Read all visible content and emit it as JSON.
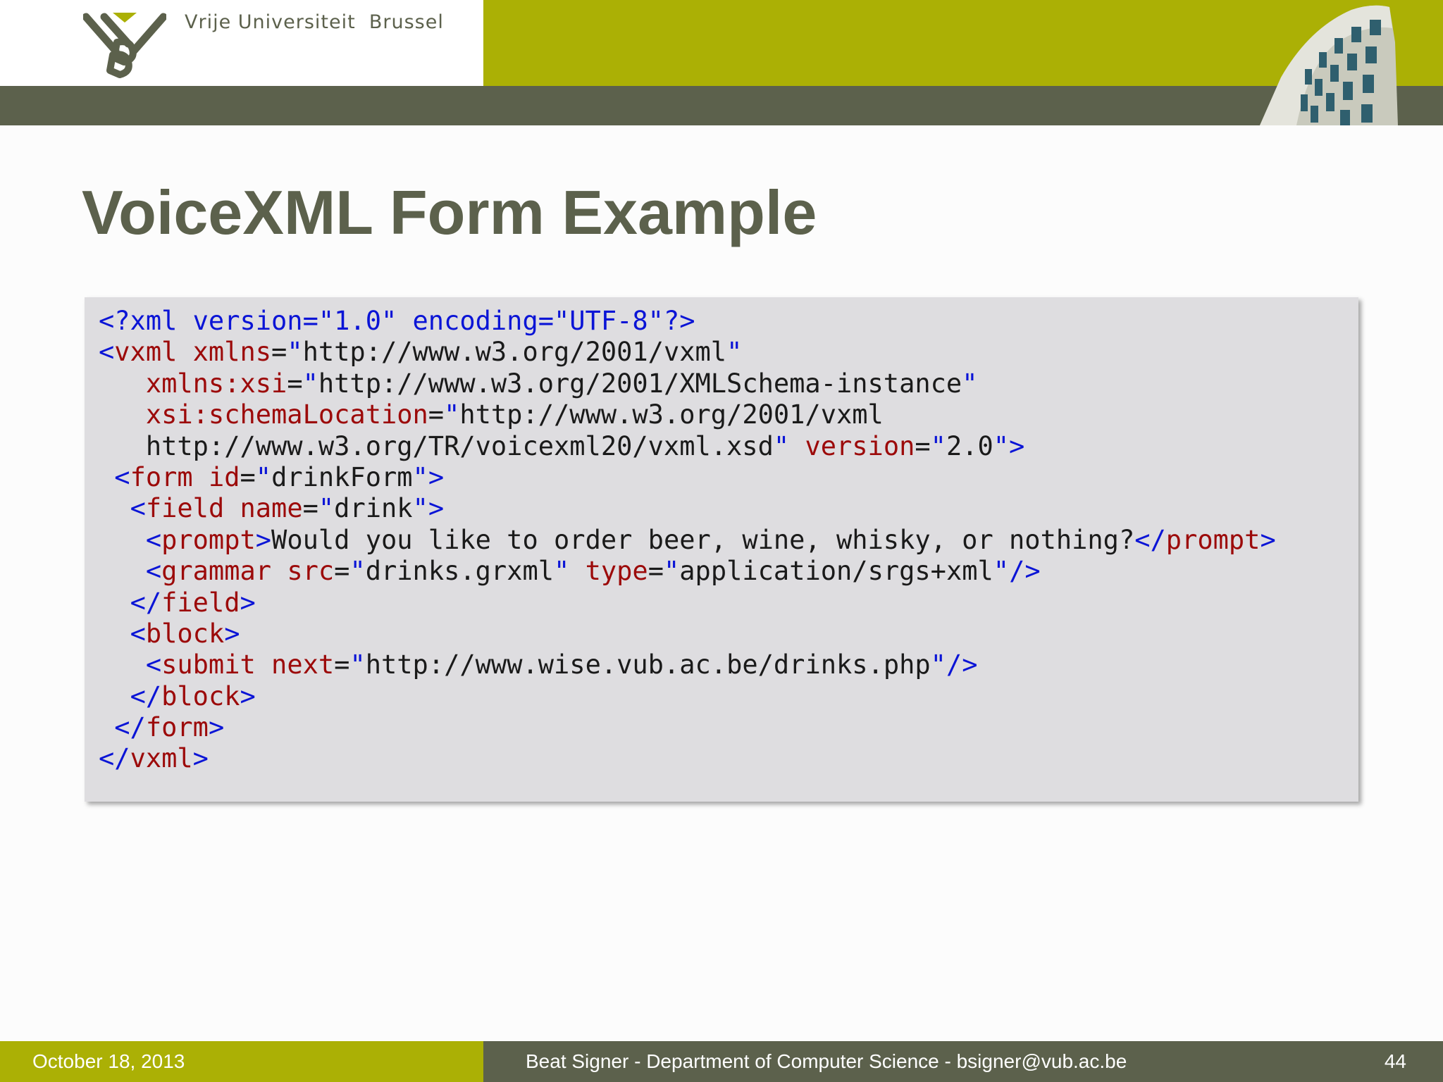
{
  "header": {
    "university_name": "Vrije Universiteit  Brussel",
    "logo_icon": "vub-logo-icon",
    "building_image": "building-photo-icon"
  },
  "slide": {
    "title": "VoiceXML Form Example"
  },
  "code": {
    "language": "xml",
    "lines": [
      [
        [
          "b",
          "<?xml version=\"1.0\" encoding=\"UTF-8\"?>"
        ]
      ],
      [
        [
          "b",
          "<"
        ],
        [
          "r",
          "vxml xmlns"
        ],
        [
          "k",
          "="
        ],
        [
          "b",
          "\""
        ],
        [
          "k",
          "http://www.w3.org/2001/vxml"
        ],
        [
          "b",
          "\""
        ]
      ],
      [
        [
          "k",
          "   "
        ],
        [
          "r",
          "xmlns:xsi"
        ],
        [
          "k",
          "="
        ],
        [
          "b",
          "\""
        ],
        [
          "k",
          "http://www.w3.org/2001/XMLSchema-instance"
        ],
        [
          "b",
          "\""
        ]
      ],
      [
        [
          "k",
          "   "
        ],
        [
          "r",
          "xsi:schemaLocation"
        ],
        [
          "k",
          "="
        ],
        [
          "b",
          "\""
        ],
        [
          "k",
          "http://www.w3.org/2001/vxml"
        ]
      ],
      [
        [
          "k",
          "   http://www.w3.org/TR/voicexml20/vxml.xsd"
        ],
        [
          "b",
          "\""
        ],
        [
          "k",
          " "
        ],
        [
          "r",
          "version"
        ],
        [
          "k",
          "="
        ],
        [
          "b",
          "\""
        ],
        [
          "k",
          "2.0"
        ],
        [
          "b",
          "\">"
        ]
      ],
      [
        [
          "k",
          " "
        ],
        [
          "b",
          "<"
        ],
        [
          "r",
          "form id"
        ],
        [
          "k",
          "="
        ],
        [
          "b",
          "\""
        ],
        [
          "k",
          "drinkForm"
        ],
        [
          "b",
          "\">"
        ]
      ],
      [
        [
          "k",
          "  "
        ],
        [
          "b",
          "<"
        ],
        [
          "r",
          "field name"
        ],
        [
          "k",
          "="
        ],
        [
          "b",
          "\""
        ],
        [
          "k",
          "drink"
        ],
        [
          "b",
          "\">"
        ]
      ],
      [
        [
          "k",
          "   "
        ],
        [
          "b",
          "<"
        ],
        [
          "r",
          "prompt"
        ],
        [
          "b",
          ">"
        ],
        [
          "k",
          "Would you like to order beer, wine, whisky, or nothing?"
        ],
        [
          "b",
          "</"
        ],
        [
          "r",
          "prompt"
        ],
        [
          "b",
          ">"
        ]
      ],
      [
        [
          "k",
          "   "
        ],
        [
          "b",
          "<"
        ],
        [
          "r",
          "grammar src"
        ],
        [
          "k",
          "="
        ],
        [
          "b",
          "\""
        ],
        [
          "k",
          "drinks.grxml"
        ],
        [
          "b",
          "\""
        ],
        [
          "k",
          " "
        ],
        [
          "r",
          "type"
        ],
        [
          "k",
          "="
        ],
        [
          "b",
          "\""
        ],
        [
          "k",
          "application/srgs+xml"
        ],
        [
          "b",
          "\"/>"
        ]
      ],
      [
        [
          "k",
          "  "
        ],
        [
          "b",
          "</"
        ],
        [
          "r",
          "field"
        ],
        [
          "b",
          ">"
        ]
      ],
      [
        [
          "k",
          "  "
        ],
        [
          "b",
          "<"
        ],
        [
          "r",
          "block"
        ],
        [
          "b",
          ">"
        ]
      ],
      [
        [
          "k",
          "   "
        ],
        [
          "b",
          "<"
        ],
        [
          "r",
          "submit next"
        ],
        [
          "k",
          "="
        ],
        [
          "b",
          "\""
        ],
        [
          "k",
          "http://www.wise.vub.ac.be/drinks.php"
        ],
        [
          "b",
          "\"/>"
        ]
      ],
      [
        [
          "k",
          "  "
        ],
        [
          "b",
          "</"
        ],
        [
          "r",
          "block"
        ],
        [
          "b",
          ">"
        ]
      ],
      [
        [
          "k",
          " "
        ],
        [
          "b",
          "</"
        ],
        [
          "r",
          "form"
        ],
        [
          "b",
          ">"
        ]
      ],
      [
        [
          "b",
          "</"
        ],
        [
          "r",
          "vxml"
        ],
        [
          "b",
          ">"
        ]
      ]
    ]
  },
  "footer": {
    "date": "October 18, 2013",
    "author": "Beat Signer - Department of Computer Science - bsigner@vub.ac.be",
    "page_number": "44"
  },
  "colors": {
    "olive": "#abb005",
    "dark_olive": "#5c614c",
    "code_background": "#dedde0",
    "syntax_blue": "#0a14d6",
    "syntax_red": "#9c0a0a"
  }
}
